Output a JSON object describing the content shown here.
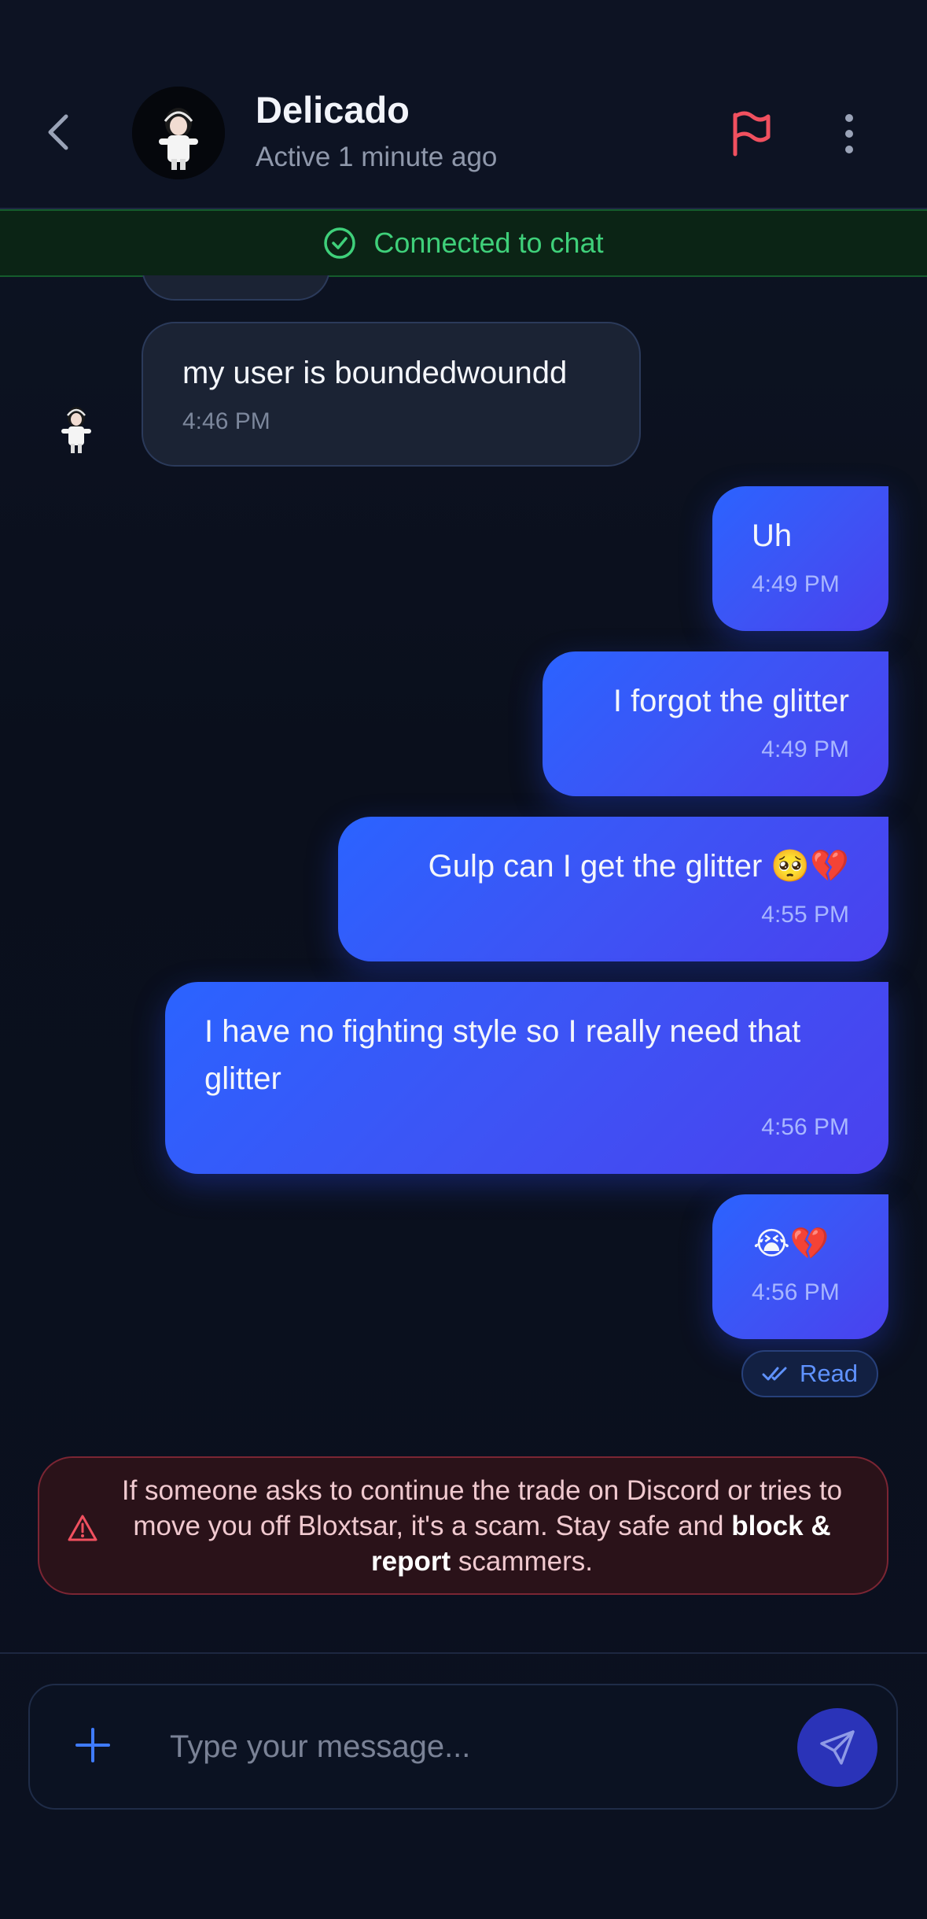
{
  "header": {
    "name": "Delicado",
    "status": "Active 1 minute ago"
  },
  "banner": {
    "text": "Connected to chat"
  },
  "messages": [
    {
      "text": "my user is boundedwoundd",
      "time": "4:46 PM",
      "from": "them"
    },
    {
      "text": "Uh",
      "time": "4:49 PM",
      "from": "me"
    },
    {
      "text": "I forgot the glitter",
      "time": "4:49 PM",
      "from": "me"
    },
    {
      "text": "Gulp can I get the glitter 🥺💔",
      "time": "4:55 PM",
      "from": "me"
    },
    {
      "text": "I have no fighting style so I really need that glitter",
      "time": "4:56 PM",
      "from": "me"
    },
    {
      "text": "😭💔",
      "time": "4:56 PM",
      "from": "me"
    }
  ],
  "read_receipt": "Read",
  "warning": {
    "text_before": "If someone asks to continue the trade on Discord or tries to move you off Bloxtsar, it's a scam. Stay safe and ",
    "text_bold": "block & report",
    "text_after": " scammers."
  },
  "composer": {
    "placeholder": "Type your message..."
  },
  "colors": {
    "accent_blue": "#2b63ff",
    "accent_violet": "#4a41ee",
    "connected_green": "#3fd07a",
    "report_red": "#f0505f",
    "background": "#0a0f1c"
  },
  "icons": [
    "back-arrow-icon",
    "flag-icon",
    "more-vertical-icon",
    "check-circle-icon",
    "double-check-icon",
    "warning-triangle-icon",
    "plus-icon",
    "send-icon"
  ]
}
